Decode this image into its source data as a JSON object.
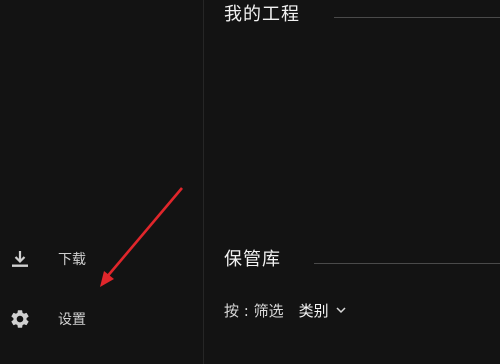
{
  "sidebar": {
    "items": [
      {
        "label": "下载",
        "icon": "download-icon"
      },
      {
        "label": "设置",
        "icon": "gear-icon"
      }
    ]
  },
  "main": {
    "projects_title": "我的工程",
    "vault_title": "保管库",
    "filter": {
      "label": "按 : 筛选",
      "selected": "类别"
    }
  },
  "colors": {
    "background": "#131313",
    "annotation_arrow": "#e0262b"
  }
}
